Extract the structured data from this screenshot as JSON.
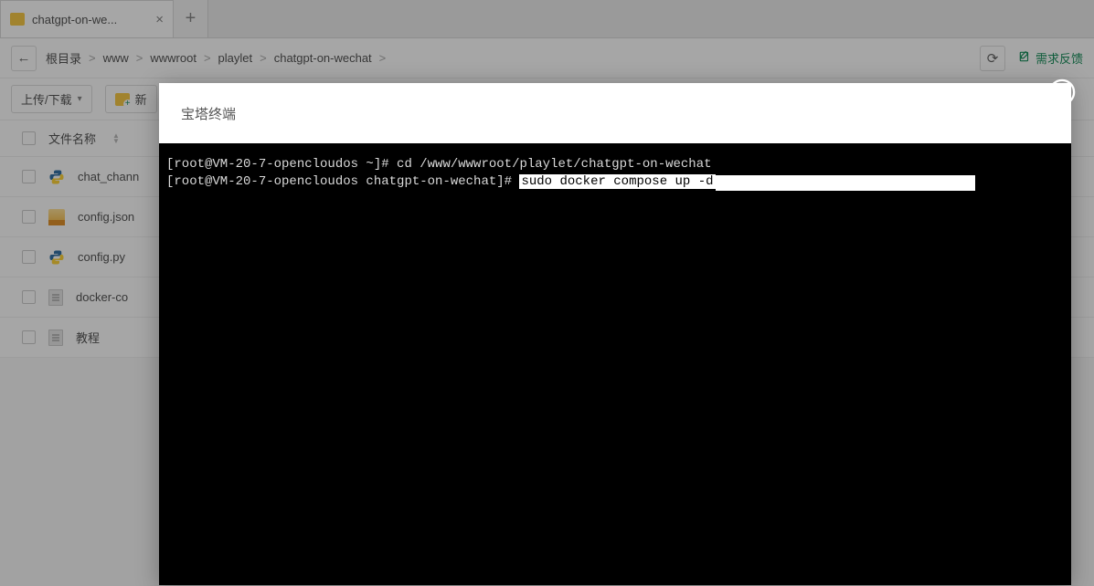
{
  "tab": {
    "title": "chatgpt-on-we..."
  },
  "breadcrumb": [
    "根目录",
    "www",
    "wwwroot",
    "playlet",
    "chatgpt-on-wechat"
  ],
  "path_separator": ">",
  "feedback_label": "需求反馈",
  "toolbar": {
    "upload_label": "上传/下载",
    "new_label": "新"
  },
  "table": {
    "col_name": "文件名称"
  },
  "files": [
    {
      "name": "chat_chann",
      "type": "py"
    },
    {
      "name": "config.json",
      "type": "json"
    },
    {
      "name": "config.py",
      "type": "py"
    },
    {
      "name": "docker-co",
      "type": "txt"
    },
    {
      "name": "教程",
      "type": "txt"
    }
  ],
  "modal": {
    "title": "宝塔终端"
  },
  "terminal": {
    "line1_prompt": "[root@VM-20-7-opencloudos ~]#",
    "line1_cmd": "cd /www/wwwroot/playlet/chatgpt-on-wechat",
    "line2_prompt": "[root@VM-20-7-opencloudos chatgpt-on-wechat]#",
    "line2_cmd": "sudo docker compose up -d"
  }
}
